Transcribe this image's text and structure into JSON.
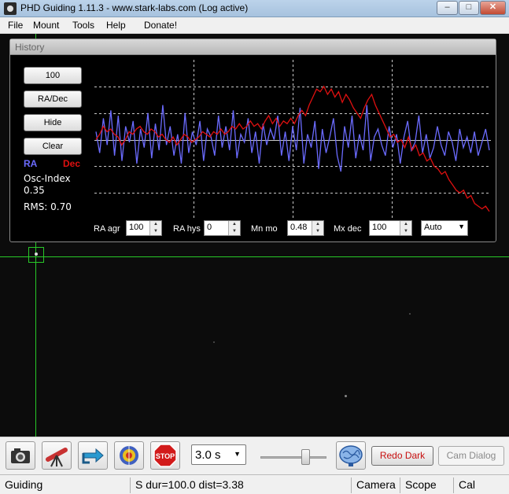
{
  "window": {
    "title": "PHD Guiding 1.11.3   -   www.stark-labs.com (Log active)",
    "minimize": "–",
    "maximize": "□",
    "close": "✕"
  },
  "menu": [
    "File",
    "Mount",
    "Tools",
    "Help",
    "Donate!"
  ],
  "history": {
    "title": "History",
    "buttons": [
      "100",
      "RA/Dec",
      "Hide",
      "Clear"
    ],
    "legend_ra": "RA",
    "legend_dec": "Dec",
    "osc_label": "Osc-Index",
    "osc_value": "0.35",
    "rms": "RMS: 0.70",
    "controls": {
      "ra_agr_label": "RA agr",
      "ra_agr_value": "100",
      "ra_hys_label": "RA hys",
      "ra_hys_value": "0",
      "mn_mo_label": "Mn mo",
      "mn_mo_value": "0.48",
      "mx_dec_label": "Mx dec",
      "mx_dec_value": "100",
      "mode_value": "Auto"
    },
    "colors": {
      "ra": "#6b6bff",
      "dec": "#e01010",
      "grid": "#c8c8c8",
      "crosshair": "#28c828"
    }
  },
  "chart_data": {
    "type": "line",
    "title": "",
    "xlabel": "",
    "ylabel": "",
    "ylim": [
      -3,
      3
    ],
    "series": [
      {
        "name": "RA",
        "values": [
          0.3,
          -0.5,
          0.8,
          -0.2,
          1.1,
          -0.6,
          0.9,
          -0.8,
          0.5,
          -0.1,
          0.7,
          -0.9,
          0.4,
          -0.3,
          1.0,
          -0.7,
          0.6,
          -0.4,
          1.3,
          -0.2,
          0.5,
          -0.6,
          0.2,
          -0.9,
          1.0,
          -0.5,
          0.3,
          -0.2,
          0.7,
          -0.8,
          0.4,
          0.1,
          -0.6,
          0.9,
          -0.3,
          0.5,
          -0.4,
          1.1,
          -0.7,
          0.2,
          -0.1,
          0.8,
          -0.5,
          0.3,
          -0.9,
          0.6,
          -0.2,
          0.4,
          0.0,
          0.9,
          -0.6,
          0.3,
          -0.8,
          0.5,
          -0.4,
          1.2,
          -0.9,
          0.2,
          -0.3,
          0.7,
          -1.1,
          0.4,
          -0.5,
          0.1,
          0.8,
          -0.6,
          -1.2,
          0.5,
          -0.3,
          0.9,
          -0.7,
          0.2,
          -0.4,
          1.3,
          -0.8,
          0.1,
          0.4,
          -0.2,
          -0.6,
          0.5,
          -0.3,
          0.2,
          -0.9,
          0.1,
          0.7,
          -0.4,
          -0.1,
          0.9,
          -0.5,
          0.2,
          -0.7,
          -0.3,
          0.5,
          -0.2,
          -0.6,
          0.3,
          -0.1,
          -0.8,
          0.4,
          -0.3,
          0.1,
          -0.5,
          0.3,
          -0.6,
          -0.1,
          0.4,
          -0.4
        ],
        "color": "#6b6bff"
      },
      {
        "name": "Dec",
        "values": [
          0.0,
          0.2,
          0.5,
          0.3,
          0.4,
          0.2,
          0.1,
          -0.2,
          0.0,
          0.3,
          0.2,
          0.4,
          0.5,
          0.3,
          0.2,
          0.4,
          0.3,
          0.1,
          0.2,
          0.0,
          -0.1,
          0.1,
          -0.2,
          0.0,
          0.2,
          0.1,
          -0.1,
          0.0,
          0.1,
          0.3,
          0.2,
          0.1,
          0.3,
          0.2,
          0.4,
          0.2,
          0.3,
          0.5,
          0.4,
          0.6,
          0.4,
          0.5,
          0.7,
          0.5,
          0.6,
          0.4,
          0.7,
          0.9,
          0.6,
          0.8,
          0.5,
          0.7,
          0.6,
          0.8,
          0.6,
          0.9,
          1.1,
          0.9,
          1.3,
          1.6,
          1.9,
          1.8,
          2.0,
          1.7,
          1.9,
          1.6,
          1.8,
          1.4,
          1.7,
          1.5,
          1.2,
          1.0,
          0.8,
          1.2,
          1.5,
          1.7,
          1.3,
          1.0,
          0.7,
          0.4,
          0.1,
          0.2,
          -0.1,
          0.0,
          -0.3,
          0.1,
          -0.4,
          -0.2,
          -0.6,
          -0.5,
          -0.8,
          -0.7,
          -1.0,
          -1.1,
          -1.3,
          -1.2,
          -1.5,
          -1.7,
          -1.9,
          -2.0,
          -1.9,
          -2.2,
          -2.1,
          -2.4,
          -2.5,
          -2.6,
          -2.5,
          -2.7
        ],
        "color": "#e01010"
      }
    ],
    "grid": true
  },
  "toolbar": {
    "exposure": "3.0 s",
    "gamma_level": 0.68,
    "redo_dark": "Redo Dark",
    "cam_dialog": "Cam Dialog",
    "icons": [
      "camera-icon",
      "telescope-icon",
      "loop-arrow-icon",
      "target-icon",
      "stop-icon",
      "brain-icon"
    ]
  },
  "status": {
    "state": "Guiding",
    "info": "S dur=100.0 dist=3.38",
    "camera": "Camera",
    "scope": "Scope",
    "cal": "Cal"
  }
}
